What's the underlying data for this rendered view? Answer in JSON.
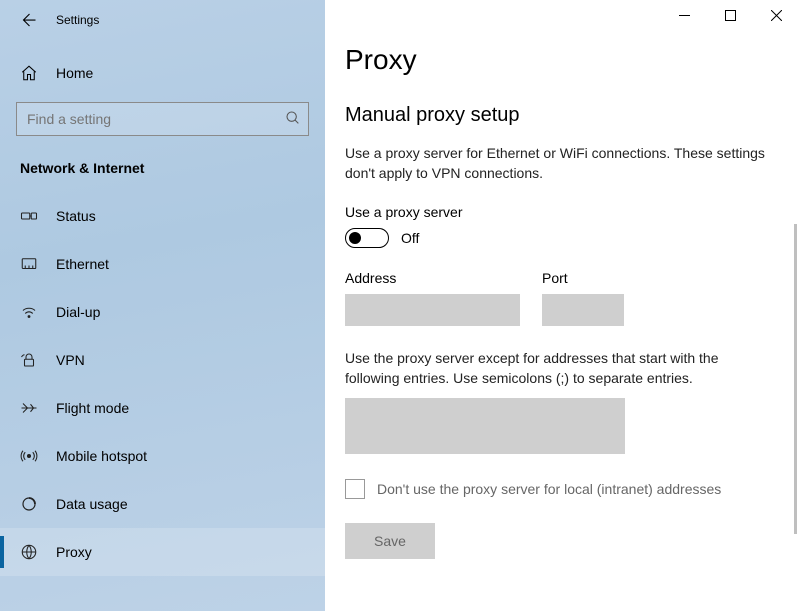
{
  "appTitle": "Settings",
  "home": {
    "label": "Home"
  },
  "search": {
    "placeholder": "Find a setting"
  },
  "sectionLabel": "Network & Internet",
  "nav": [
    {
      "id": "status",
      "label": "Status",
      "selected": false
    },
    {
      "id": "ethernet",
      "label": "Ethernet",
      "selected": false
    },
    {
      "id": "dialup",
      "label": "Dial-up",
      "selected": false
    },
    {
      "id": "vpn",
      "label": "VPN",
      "selected": false
    },
    {
      "id": "flightmode",
      "label": "Flight mode",
      "selected": false
    },
    {
      "id": "mobilehotspot",
      "label": "Mobile hotspot",
      "selected": false
    },
    {
      "id": "datausage",
      "label": "Data usage",
      "selected": false
    },
    {
      "id": "proxy",
      "label": "Proxy",
      "selected": true
    }
  ],
  "page": {
    "title": "Proxy",
    "manualHeading": "Manual proxy setup",
    "manualDesc": "Use a proxy server for Ethernet or WiFi connections. These settings don't apply to VPN connections.",
    "useProxyLabel": "Use a proxy server",
    "toggleState": "Off",
    "addressLabel": "Address",
    "addressValue": "",
    "portLabel": "Port",
    "portValue": "",
    "exceptionsDesc": "Use the proxy server except for addresses that start with the following entries. Use semicolons (;) to separate entries.",
    "exceptionsValue": "",
    "localBypassLabel": "Don't use the proxy server for local (intranet) addresses",
    "saveLabel": "Save"
  }
}
